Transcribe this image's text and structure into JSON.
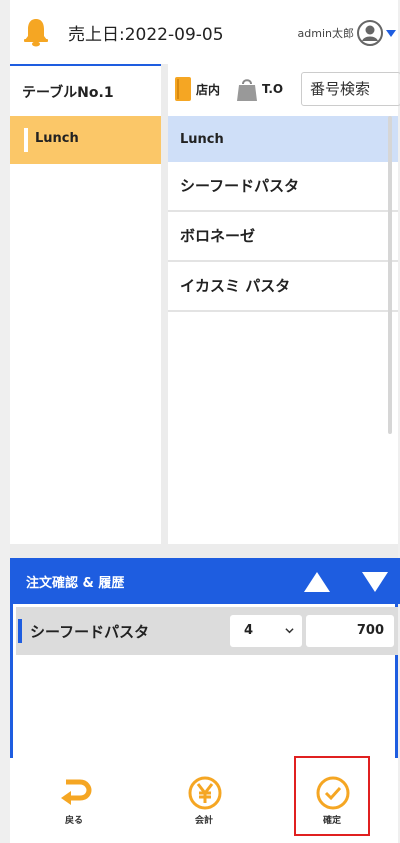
{
  "header": {
    "sales_date_label": "売上日:",
    "sales_date": "2022-09-05",
    "user_name": "admin太郎"
  },
  "left": {
    "table_label": "テーブルNo.1",
    "categories": [
      {
        "label": "Lunch",
        "selected": true
      }
    ]
  },
  "order_type": {
    "instore_label": "店内",
    "takeout_label": "T.O",
    "search_placeholder": "番号検索"
  },
  "menu": {
    "header": "Lunch",
    "items": [
      {
        "label": "シーフードパスタ"
      },
      {
        "label": "ボロネーゼ"
      },
      {
        "label": "イカスミ パスタ"
      }
    ]
  },
  "order": {
    "title": "注文確認 & 履歴",
    "rows": [
      {
        "name": "シーフードパスタ",
        "qty": "4",
        "price": "700"
      }
    ]
  },
  "footer": {
    "back_label": "戻る",
    "checkout_label": "会計",
    "confirm_label": "確定"
  },
  "colors": {
    "accent_orange": "#f5a623",
    "primary_blue": "#1e5de0",
    "category_selected": "#fbc768",
    "menu_header_bg": "#cfdff8",
    "highlight_red": "#e02020"
  }
}
